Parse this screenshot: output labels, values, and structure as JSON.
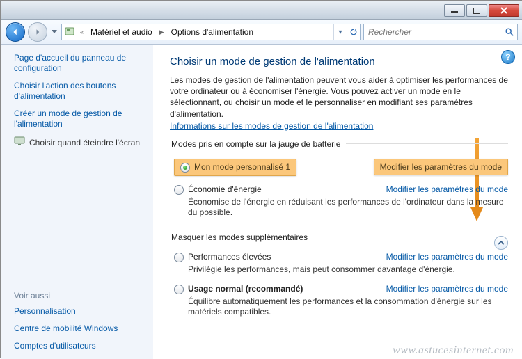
{
  "titlebar": {
    "minimize": "minimize",
    "maximize": "maximize",
    "close": "close"
  },
  "nav": {
    "icon": "control-panel",
    "crumbs": [
      "Matériel et audio",
      "Options d'alimentation"
    ]
  },
  "search": {
    "placeholder": "Rechercher"
  },
  "sidebar": {
    "links": [
      "Page d'accueil du panneau de configuration",
      "Choisir l'action des boutons d'alimentation",
      "Créer un mode de gestion de l'alimentation"
    ],
    "selected": "Choisir quand éteindre l'écran",
    "see_also_label": "Voir aussi",
    "see_also": [
      "Personnalisation",
      "Centre de mobilité Windows",
      "Comptes d'utilisateurs"
    ]
  },
  "main": {
    "heading": "Choisir un mode de gestion de l'alimentation",
    "paragraph": "Les modes de gestion de l'alimentation peuvent vous aider à optimiser les performances de votre ordinateur ou à économiser l'énergie. Vous pouvez activer un mode en le sélectionnant, ou choisir un mode et le personnaliser en modifiant ses paramètres d'alimentation.",
    "info_link": "Informations sur les modes de gestion de l'alimentation",
    "section1_legend": "Modes pris en compte sur la jauge de batterie",
    "section2_legend": "Masquer les modes supplémentaires",
    "modify_label": "Modifier les paramètres du mode",
    "plans": {
      "custom": {
        "name": "Mon mode personnalisé 1"
      },
      "eco": {
        "name": "Économie d'énergie",
        "detail": "Économise de l'énergie en réduisant les performances de l'ordinateur dans la mesure du possible."
      },
      "perf": {
        "name": "Performances élevées",
        "detail": "Privilégie les performances, mais peut consommer davantage d'énergie."
      },
      "normal": {
        "name": "Usage normal (recommandé)",
        "detail": "Équilibre automatiquement les performances et la consommation d'énergie sur les matériels compatibles."
      }
    }
  },
  "watermark": "www.astucesinternet.com"
}
